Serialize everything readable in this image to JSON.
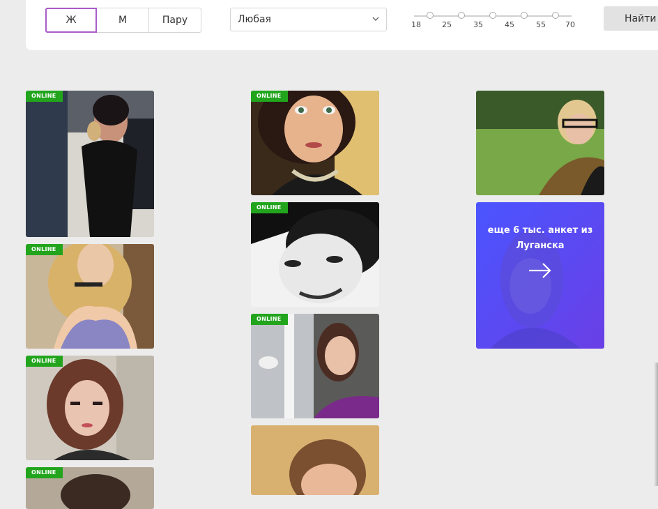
{
  "filters": {
    "gender": [
      {
        "label": "Ж",
        "active": true
      },
      {
        "label": "М",
        "active": false
      },
      {
        "label": "Пару",
        "active": false
      }
    ],
    "select": {
      "value": "Любая"
    },
    "age_ticks": [
      "18",
      "25",
      "35",
      "45",
      "55",
      "70"
    ],
    "find_label": "Найти"
  },
  "profiles": {
    "badge_label": "ONLINE",
    "col1": [
      {
        "online": true
      },
      {
        "online": true
      },
      {
        "online": true
      },
      {
        "online": true
      }
    ],
    "col2": [
      {
        "online": true
      },
      {
        "online": true
      },
      {
        "online": true
      },
      {
        "online": false
      }
    ],
    "col3": [
      {
        "online": false
      }
    ]
  },
  "promo": {
    "line1": "еще 6 тыс. анкет из",
    "line2": "Луганска",
    "accent_color": "#5a3df0"
  }
}
